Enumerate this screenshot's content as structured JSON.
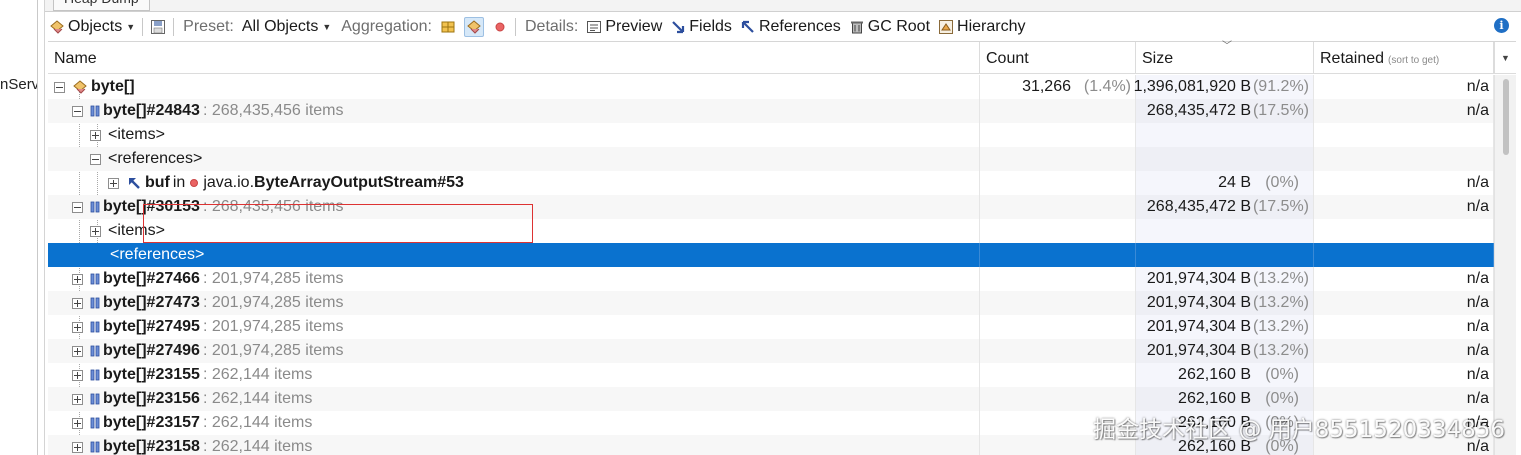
{
  "window": {
    "tab_title": "Heap Dump",
    "left_fragment": "nServ"
  },
  "toolbar": {
    "objects_label": "Objects",
    "preset_label": "Preset:",
    "preset_value": "All Objects",
    "aggregation_label": "Aggregation:",
    "details_label": "Details:",
    "preview_label": "Preview",
    "fields_label": "Fields",
    "references_label": "References",
    "gcroot_label": "GC Root",
    "hierarchy_label": "Hierarchy",
    "info_icon": "i"
  },
  "columns": {
    "name": "Name",
    "count": "Count",
    "size": "Size",
    "retained": "Retained",
    "retained_hint": "(sort to get)"
  },
  "rows": {
    "root": {
      "name": "byte[]",
      "count": "31,266",
      "count_pct": "(1.4%)",
      "size": "1,396,081,920 B",
      "size_pct": "(91.2%)",
      "retained": "n/a"
    },
    "r1": {
      "name": "byte[]#24843",
      "suffix": ": 268,435,456 items",
      "size": "268,435,472 B",
      "size_pct": "(17.5%)",
      "retained": "n/a"
    },
    "r1_items": {
      "name": "<items>"
    },
    "r1_refs": {
      "name": "<references>"
    },
    "r1_buf": {
      "field": "buf",
      "in": "in",
      "pkg": "java.io.",
      "cls": "ByteArrayOutputStream#53",
      "size": "24 B",
      "size_pct": "(0%)",
      "retained": "n/a"
    },
    "r2": {
      "name": "byte[]#30153",
      "suffix": ": 268,435,456 items",
      "size": "268,435,472 B",
      "size_pct": "(17.5%)",
      "retained": "n/a"
    },
    "r2_items": {
      "name": "<items>"
    },
    "r2_refs": {
      "name": "<references>"
    },
    "list": [
      {
        "name": "byte[]#27466",
        "suffix": ": 201,974,285 items",
        "size": "201,974,304 B",
        "size_pct": "(13.2%)",
        "retained": "n/a"
      },
      {
        "name": "byte[]#27473",
        "suffix": ": 201,974,285 items",
        "size": "201,974,304 B",
        "size_pct": "(13.2%)",
        "retained": "n/a"
      },
      {
        "name": "byte[]#27495",
        "suffix": ": 201,974,285 items",
        "size": "201,974,304 B",
        "size_pct": "(13.2%)",
        "retained": "n/a"
      },
      {
        "name": "byte[]#27496",
        "suffix": ": 201,974,285 items",
        "size": "201,974,304 B",
        "size_pct": "(13.2%)",
        "retained": "n/a"
      },
      {
        "name": "byte[]#23155",
        "suffix": ": 262,144 items",
        "size": "262,160 B",
        "size_pct": "(0%)",
        "retained": "n/a"
      },
      {
        "name": "byte[]#23156",
        "suffix": ": 262,144 items",
        "size": "262,160 B",
        "size_pct": "(0%)",
        "retained": "n/a"
      },
      {
        "name": "byte[]#23157",
        "suffix": ": 262,144 items",
        "size": "262,160 B",
        "size_pct": "(0%)",
        "retained": "n/a"
      },
      {
        "name": "byte[]#23158",
        "suffix": ": 262,144 items",
        "size": "262,160 B",
        "size_pct": "(0%)",
        "retained": "n/a"
      }
    ]
  },
  "watermark": "掘金技术社区 @ 用户8551520334856",
  "colors": {
    "selection": "#0a72cf",
    "highlight_box": "#dd3333",
    "accent": "#1f6fc5"
  }
}
